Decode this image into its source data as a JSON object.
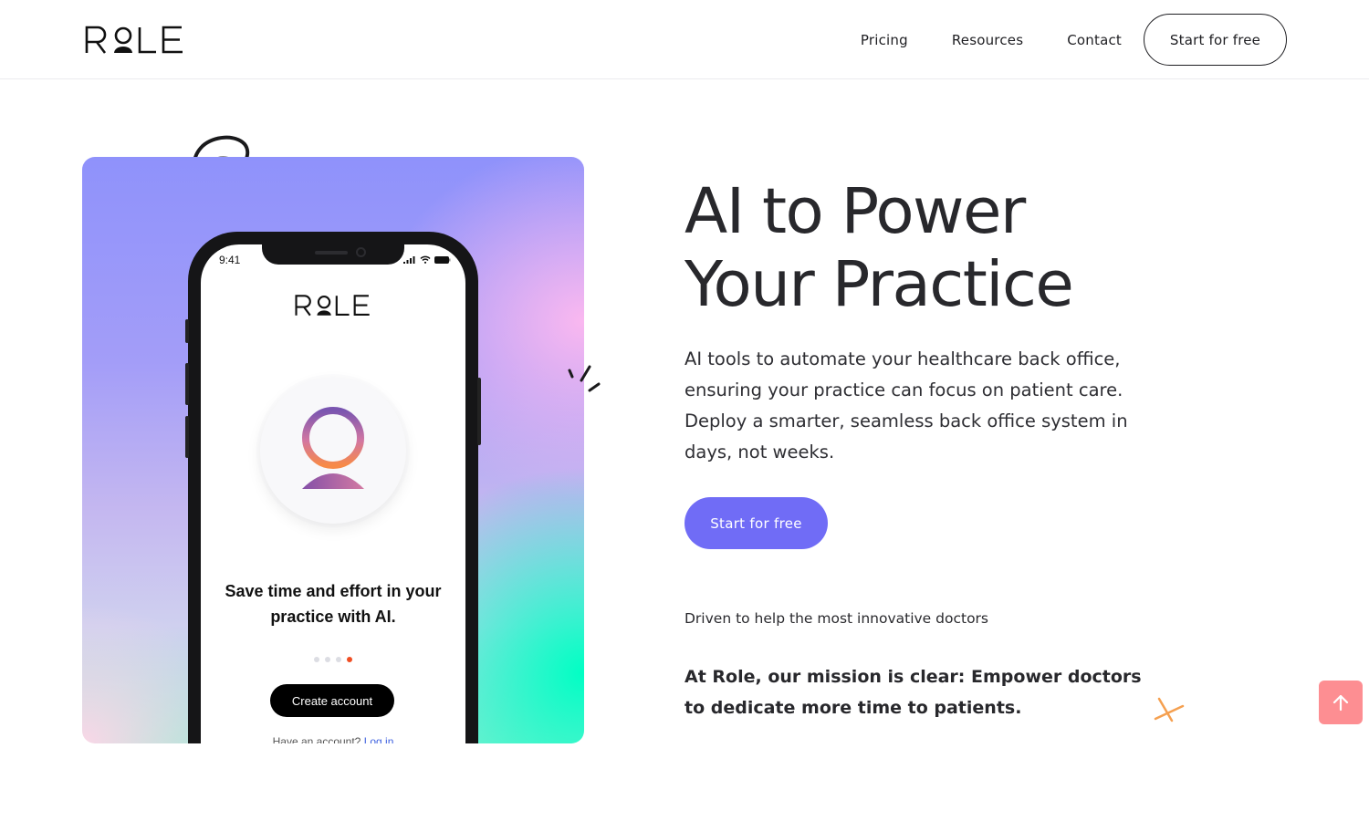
{
  "header": {
    "logo_text": "ROLE",
    "nav": [
      {
        "label": "Pricing"
      },
      {
        "label": "Resources"
      },
      {
        "label": "Contact"
      }
    ],
    "cta_label": "Start for free"
  },
  "hero": {
    "title_line1": "AI to Power",
    "title_line2": "Your Practice",
    "description": "AI tools to automate your healthcare back office, ensuring your practice can focus on patient care. Deploy a smarter, seamless back office system in days, not weeks.",
    "cta_label": "Start for free",
    "tagline": "Driven to help the most innovative doctors",
    "mission": "At Role, our mission is clear: Empower doctors to dedicate more time to patients."
  },
  "phone_mockup": {
    "status_time": "9:41",
    "app_logo_text": "ROLE",
    "headline": "Save time and effort in your practice with AI.",
    "carousel": {
      "total": 4,
      "active_index": 3
    },
    "create_account_label": "Create account",
    "login_prompt": "Have an account?",
    "login_link": "Log in"
  },
  "colors": {
    "primary": "#706cf6",
    "text": "#28282c",
    "scroll_top": "#fd8e92",
    "carousel_active": "#f04e23",
    "doodle_accent": "#f5a050"
  },
  "icons": {
    "scroll_top": "arrow-up-icon",
    "swirl": "swirl-doodle-icon",
    "sparkle": "sparkle-doodle-icon",
    "cross": "cross-doodle-icon"
  }
}
